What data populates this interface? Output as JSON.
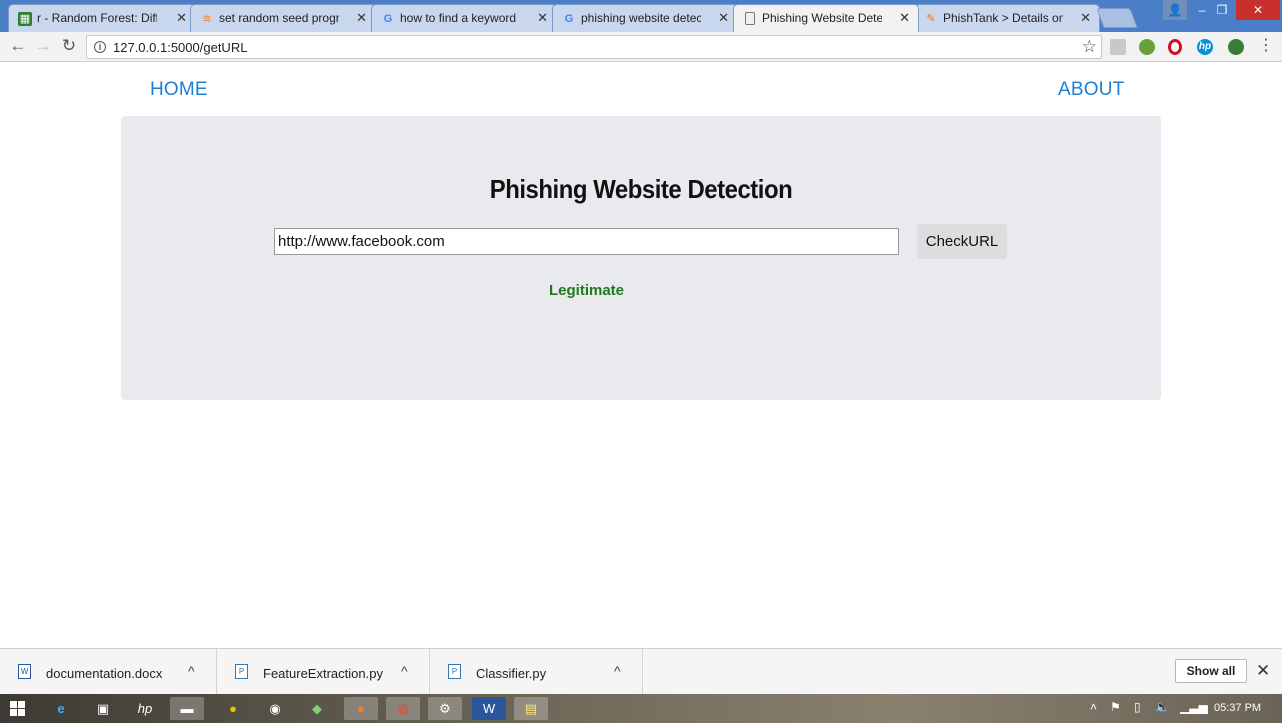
{
  "browser": {
    "tabs": [
      {
        "label": "r - Random Forest: Differ",
        "icon": "spreadsheet-icon",
        "color": "#2e7d32"
      },
      {
        "label": "set random seed program",
        "icon": "stackoverflow-icon",
        "color": "#f48024"
      },
      {
        "label": "how to find a keyword in",
        "icon": "google-icon",
        "color": "#4285f4"
      },
      {
        "label": "phishing website detectic",
        "icon": "google-icon",
        "color": "#4285f4"
      },
      {
        "label": "Phishing Website Detecti",
        "icon": "page-icon",
        "color": "#777777"
      },
      {
        "label": "PhishTank > Details on su",
        "icon": "phishtank-icon",
        "color": "#f57c00"
      }
    ],
    "close_glyph": "✕",
    "url": "127.0.0.1:5000/getURL",
    "window_user_glyph": "👤",
    "window_min_glyph": "–",
    "window_max_glyph": "❐",
    "window_close_glyph": "✕"
  },
  "page": {
    "nav": {
      "home": "HOME",
      "about": "ABOUT"
    },
    "title": "Phishing Website Detection",
    "url_input_value": "http://www.facebook.com",
    "check_button": "CheckURL",
    "result": "Legitimate",
    "colors": {
      "link": "#1e7fd6",
      "panel": "#e8eaed",
      "result": "#1d7a1d"
    }
  },
  "downloads": {
    "items": [
      {
        "name": "documentation.docx",
        "icon": "word-doc-icon"
      },
      {
        "name": "FeatureExtraction.py",
        "icon": "python-file-icon"
      },
      {
        "name": "Classifier.py",
        "icon": "python-file-icon"
      }
    ],
    "show_all": "Show all"
  },
  "taskbar": {
    "apps": [
      "windows-start",
      "ie-icon",
      "store-icon",
      "hp-icon",
      "file-explorer-icon",
      "app-icon",
      "media-icon",
      "app-icon",
      "firefox-icon",
      "chrome-icon",
      "settings-icon",
      "word-icon",
      "notes-icon"
    ],
    "clock": "05:37 PM"
  }
}
